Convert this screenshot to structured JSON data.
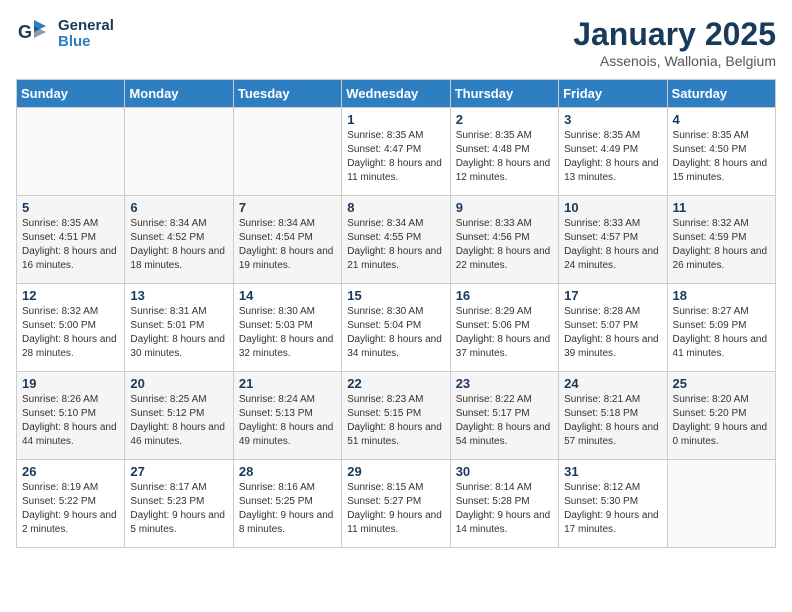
{
  "header": {
    "logo_line1": "General",
    "logo_line2": "Blue",
    "title": "January 2025",
    "subtitle": "Assenois, Wallonia, Belgium"
  },
  "days_of_week": [
    "Sunday",
    "Monday",
    "Tuesday",
    "Wednesday",
    "Thursday",
    "Friday",
    "Saturday"
  ],
  "weeks": [
    [
      {
        "day": "",
        "info": ""
      },
      {
        "day": "",
        "info": ""
      },
      {
        "day": "",
        "info": ""
      },
      {
        "day": "1",
        "info": "Sunrise: 8:35 AM\nSunset: 4:47 PM\nDaylight: 8 hours\nand 11 minutes."
      },
      {
        "day": "2",
        "info": "Sunrise: 8:35 AM\nSunset: 4:48 PM\nDaylight: 8 hours\nand 12 minutes."
      },
      {
        "day": "3",
        "info": "Sunrise: 8:35 AM\nSunset: 4:49 PM\nDaylight: 8 hours\nand 13 minutes."
      },
      {
        "day": "4",
        "info": "Sunrise: 8:35 AM\nSunset: 4:50 PM\nDaylight: 8 hours\nand 15 minutes."
      }
    ],
    [
      {
        "day": "5",
        "info": "Sunrise: 8:35 AM\nSunset: 4:51 PM\nDaylight: 8 hours\nand 16 minutes."
      },
      {
        "day": "6",
        "info": "Sunrise: 8:34 AM\nSunset: 4:52 PM\nDaylight: 8 hours\nand 18 minutes."
      },
      {
        "day": "7",
        "info": "Sunrise: 8:34 AM\nSunset: 4:54 PM\nDaylight: 8 hours\nand 19 minutes."
      },
      {
        "day": "8",
        "info": "Sunrise: 8:34 AM\nSunset: 4:55 PM\nDaylight: 8 hours\nand 21 minutes."
      },
      {
        "day": "9",
        "info": "Sunrise: 8:33 AM\nSunset: 4:56 PM\nDaylight: 8 hours\nand 22 minutes."
      },
      {
        "day": "10",
        "info": "Sunrise: 8:33 AM\nSunset: 4:57 PM\nDaylight: 8 hours\nand 24 minutes."
      },
      {
        "day": "11",
        "info": "Sunrise: 8:32 AM\nSunset: 4:59 PM\nDaylight: 8 hours\nand 26 minutes."
      }
    ],
    [
      {
        "day": "12",
        "info": "Sunrise: 8:32 AM\nSunset: 5:00 PM\nDaylight: 8 hours\nand 28 minutes."
      },
      {
        "day": "13",
        "info": "Sunrise: 8:31 AM\nSunset: 5:01 PM\nDaylight: 8 hours\nand 30 minutes."
      },
      {
        "day": "14",
        "info": "Sunrise: 8:30 AM\nSunset: 5:03 PM\nDaylight: 8 hours\nand 32 minutes."
      },
      {
        "day": "15",
        "info": "Sunrise: 8:30 AM\nSunset: 5:04 PM\nDaylight: 8 hours\nand 34 minutes."
      },
      {
        "day": "16",
        "info": "Sunrise: 8:29 AM\nSunset: 5:06 PM\nDaylight: 8 hours\nand 37 minutes."
      },
      {
        "day": "17",
        "info": "Sunrise: 8:28 AM\nSunset: 5:07 PM\nDaylight: 8 hours\nand 39 minutes."
      },
      {
        "day": "18",
        "info": "Sunrise: 8:27 AM\nSunset: 5:09 PM\nDaylight: 8 hours\nand 41 minutes."
      }
    ],
    [
      {
        "day": "19",
        "info": "Sunrise: 8:26 AM\nSunset: 5:10 PM\nDaylight: 8 hours\nand 44 minutes."
      },
      {
        "day": "20",
        "info": "Sunrise: 8:25 AM\nSunset: 5:12 PM\nDaylight: 8 hours\nand 46 minutes."
      },
      {
        "day": "21",
        "info": "Sunrise: 8:24 AM\nSunset: 5:13 PM\nDaylight: 8 hours\nand 49 minutes."
      },
      {
        "day": "22",
        "info": "Sunrise: 8:23 AM\nSunset: 5:15 PM\nDaylight: 8 hours\nand 51 minutes."
      },
      {
        "day": "23",
        "info": "Sunrise: 8:22 AM\nSunset: 5:17 PM\nDaylight: 8 hours\nand 54 minutes."
      },
      {
        "day": "24",
        "info": "Sunrise: 8:21 AM\nSunset: 5:18 PM\nDaylight: 8 hours\nand 57 minutes."
      },
      {
        "day": "25",
        "info": "Sunrise: 8:20 AM\nSunset: 5:20 PM\nDaylight: 9 hours\nand 0 minutes."
      }
    ],
    [
      {
        "day": "26",
        "info": "Sunrise: 8:19 AM\nSunset: 5:22 PM\nDaylight: 9 hours\nand 2 minutes."
      },
      {
        "day": "27",
        "info": "Sunrise: 8:17 AM\nSunset: 5:23 PM\nDaylight: 9 hours\nand 5 minutes."
      },
      {
        "day": "28",
        "info": "Sunrise: 8:16 AM\nSunset: 5:25 PM\nDaylight: 9 hours\nand 8 minutes."
      },
      {
        "day": "29",
        "info": "Sunrise: 8:15 AM\nSunset: 5:27 PM\nDaylight: 9 hours\nand 11 minutes."
      },
      {
        "day": "30",
        "info": "Sunrise: 8:14 AM\nSunset: 5:28 PM\nDaylight: 9 hours\nand 14 minutes."
      },
      {
        "day": "31",
        "info": "Sunrise: 8:12 AM\nSunset: 5:30 PM\nDaylight: 9 hours\nand 17 minutes."
      },
      {
        "day": "",
        "info": ""
      }
    ]
  ]
}
